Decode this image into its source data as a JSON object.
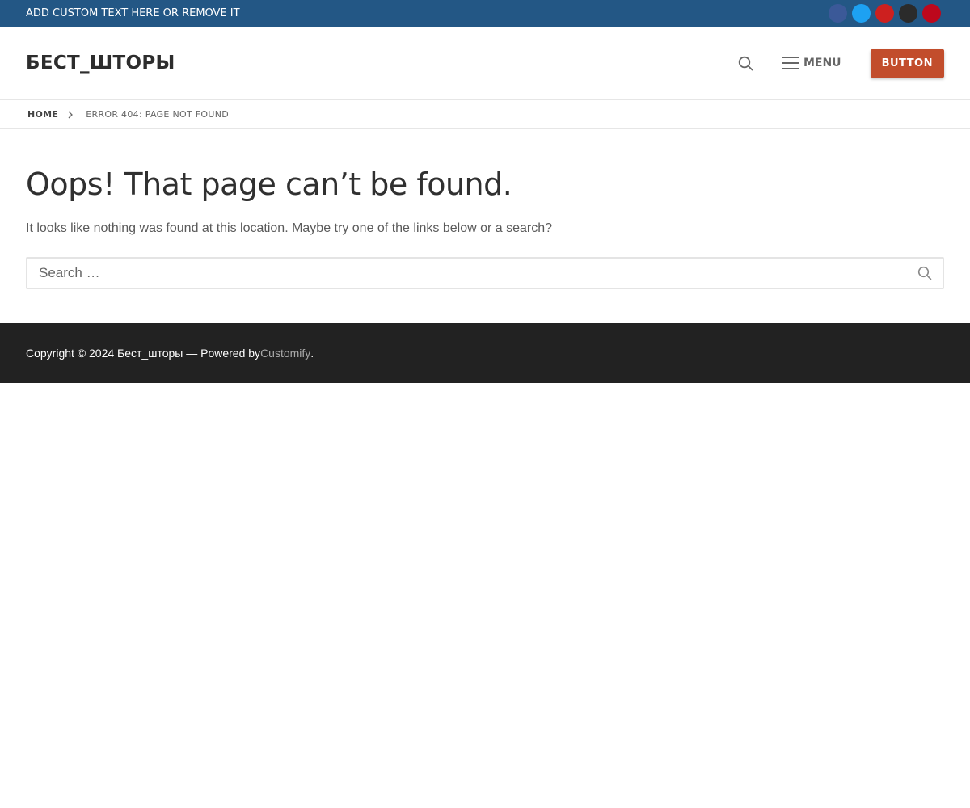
{
  "topbar": {
    "text": "ADD CUSTOM TEXT HERE OR REMOVE IT",
    "background": "#235785",
    "social": [
      {
        "icon": "facebook-icon",
        "glyph": "",
        "color": "#3b5998"
      },
      {
        "icon": "twitter-icon",
        "glyph": "",
        "color": "#1da1f2"
      },
      {
        "icon": "youtube-icon",
        "glyph": "",
        "color": "#cd201f"
      },
      {
        "icon": "instagram-icon",
        "glyph": "",
        "color": "#2b2b2b"
      },
      {
        "icon": "pinterest-icon",
        "glyph": "",
        "color": "#bd081c"
      }
    ]
  },
  "header": {
    "logo": "БЕСТ_ШТОРЫ",
    "menu_label": "MENU",
    "button_label": "BUTTON",
    "button_color": "#c24d2c",
    "search_icon": "search-icon",
    "menu_icon": "hamburger-icon"
  },
  "breadcrumb": {
    "home": "HOME",
    "separator_icon": "chevron-right-icon",
    "current": "ERROR 404: PAGE NOT FOUND"
  },
  "main": {
    "title": "Oops! That page can’t be found.",
    "description": "It looks like nothing was found at this location. Maybe try one of the links below or a search?",
    "search_placeholder": "Search …",
    "search_value": "",
    "search_submit_icon": "search-icon"
  },
  "footer": {
    "copyright": "Copyright © 2024 Бест_шторы — Powered by ",
    "link_text": "Customify",
    "suffix": ".",
    "background": "#222222"
  }
}
